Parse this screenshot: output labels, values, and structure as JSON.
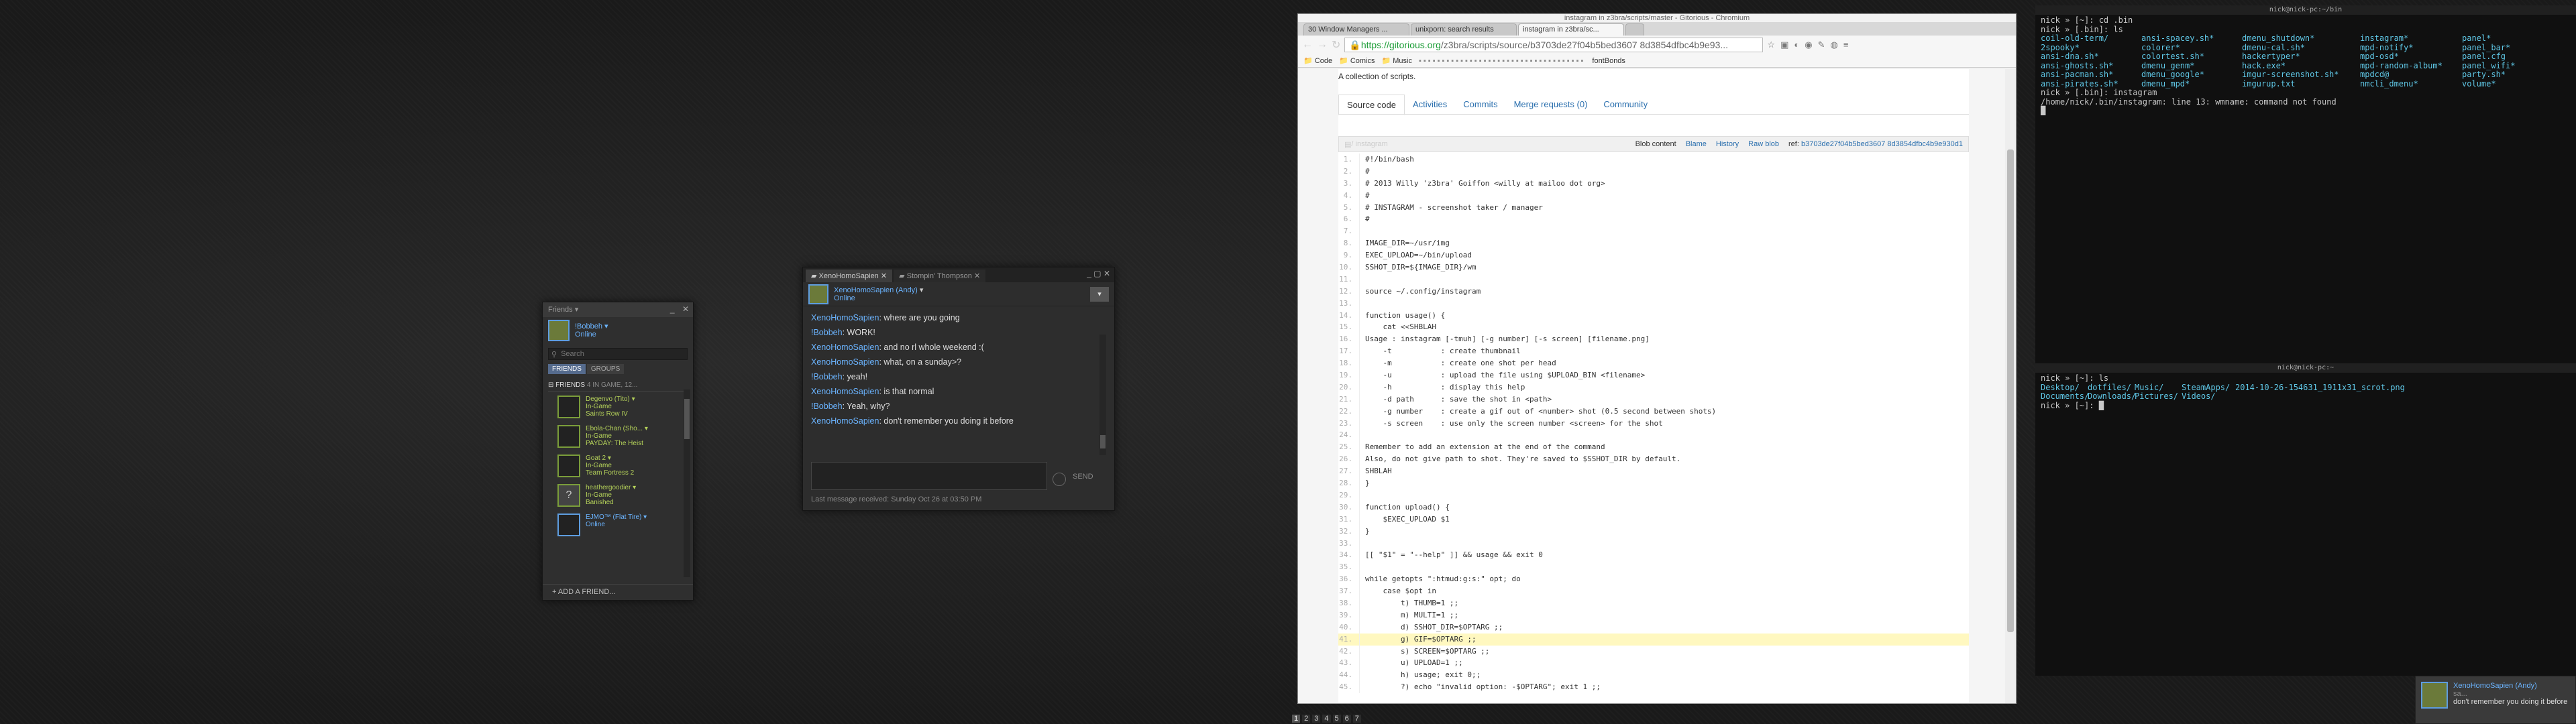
{
  "friends": {
    "title": "Friends",
    "window_controls": [
      "_",
      "✕"
    ],
    "me": {
      "name": "!Bobbeh",
      "status": "Online"
    },
    "search_placeholder": "Search",
    "tabs": [
      "FRIENDS",
      "GROUPS"
    ],
    "group_header": "FRIENDS",
    "group_count": "4 IN GAME, 12...",
    "list": [
      {
        "name": "Degenvo (Tito)",
        "state": "In-Game",
        "game": "Saints Row IV"
      },
      {
        "name": "Ebola-Chan (Sho...",
        "state": "In-Game",
        "game": "PAYDAY: The Heist"
      },
      {
        "name": "Goat 2",
        "state": "In-Game",
        "game": "Team Fortress 2"
      },
      {
        "name": "heathergoodier",
        "state": "In-Game",
        "game": "Banished"
      },
      {
        "name": "EJMO™ (Flat Tire)",
        "state": "Online",
        "game": ""
      }
    ],
    "add_friend": "ADD A FRIEND..."
  },
  "chat": {
    "tabs": [
      "XenoHomoSapien",
      "Stompin' Thompson"
    ],
    "partner": {
      "name": "XenoHomoSapien (Andy)",
      "status": "Online"
    },
    "messages": [
      {
        "from": "XenoHomoSapien",
        "text": ": where are you going"
      },
      {
        "from": "!Bobbeh",
        "text": ": WORK!"
      },
      {
        "from": "XenoHomoSapien",
        "text": ": and no rl whole weekend :("
      },
      {
        "from": "XenoHomoSapien",
        "text": ": what, on a sunday>?"
      },
      {
        "from": "!Bobbeh",
        "text": ": yeah!"
      },
      {
        "from": "XenoHomoSapien",
        "text": ": is that normal"
      },
      {
        "from": "!Bobbeh",
        "text": ": Yeah, why?"
      },
      {
        "from": "XenoHomoSapien",
        "text": ": don't remember you doing it before"
      }
    ],
    "send_label": "SEND",
    "last_message": "Last message received: Sunday Oct 26 at 03:50 PM"
  },
  "browser": {
    "window_title": "instagram in z3bra/scripts/master - Gitorious - Chromium",
    "tabs": [
      "30 Window Managers ...",
      "unixporn: search results",
      "instagram in z3bra/sc..."
    ],
    "url_host": "https://gitorious.org",
    "url_path": "/z3bra/scripts/source/b3703de27f04b5bed3607 8d3854dfbc4b9e93...",
    "bookmarks": [
      "Code",
      "Comics",
      "Music",
      "fontBonds"
    ],
    "description": "A collection of scripts.",
    "project_tabs": [
      "Source code",
      "Activities",
      "Commits",
      "Merge requests (0)",
      "Community"
    ],
    "file_name": "/ instagram",
    "blob_links": [
      "Blob content",
      "Blame",
      "History",
      "Raw blob"
    ],
    "ref_label": "ref:",
    "ref_hash": "b3703de27f04b5bed3607 8d3854dfbc4b9e930d1",
    "code": [
      "#!/bin/bash",
      "#",
      "# 2013 Willy 'z3bra' Goiffon <willy at mailoo dot org>",
      "#",
      "# INSTAGRAM - screenshot taker / manager",
      "#",
      "",
      "IMAGE_DIR=~/usr/img",
      "EXEC_UPLOAD=~/bin/upload",
      "SSHOT_DIR=${IMAGE_DIR}/wm",
      "",
      "source ~/.config/instagram",
      "",
      "function usage() {",
      "    cat <<SHBLAH",
      "Usage : instagram [-tmuh] [-g number] [-s screen] [filename.png]",
      "    -t           : create thumbnail",
      "    -m           : create one shot per head",
      "    -u           : upload the file using $UPLOAD_BIN <filename>",
      "    -h           : display this help",
      "    -d path      : save the shot in <path>",
      "    -g number    : create a gif out of <number> shot (0.5 second between shots)",
      "    -s screen    : use only the screen number <screen> for the shot",
      "",
      "Remember to add an extension at the end of the command",
      "Also, do not give path to shot. They're saved to $SSHOT_DIR by default.",
      "SHBLAH",
      "}",
      "",
      "function upload() {",
      "    $EXEC_UPLOAD $1",
      "}",
      "",
      "[[ \"$1\" = \"--help\" ]] && usage && exit 0",
      "",
      "while getopts \":htmud:g:s:\" opt; do",
      "    case $opt in",
      "        t) THUMB=1 ;;",
      "        m) MULTI=1 ;;",
      "        d) SSHOT_DIR=$OPTARG ;;",
      "        g) GIF=$OPTARG ;;",
      "        s) SCREEN=$OPTARG ;;",
      "        u) UPLOAD=1 ;;",
      "        h) usage; exit 0;;",
      "        ?) echo \"invalid option: -$OPTARG\"; exit 1 ;;"
    ],
    "highlight_line": 41
  },
  "term1": {
    "title": "nick@nick-pc:~/bin",
    "lines_before": [
      "nick » [~]: cd .bin",
      "nick » [.bin]: ls"
    ],
    "ls_columns": [
      [
        "coil-old-term/",
        "2spooky*",
        "ansi-dna.sh*",
        "ansi-ghosts.sh*",
        "ansi-pacman.sh*",
        "ansi-pirates.sh*"
      ],
      [
        "ansi-spacey.sh*",
        "colorer*",
        "colortest.sh*",
        "dmenu_genm*",
        "dmenu_google*",
        "dmenu_mpd*"
      ],
      [
        "dmenu_shutdown*",
        "dmenu-cal.sh*",
        "hackertyper*",
        "hack.exe*",
        "imgur-screenshot.sh*",
        "imgurup.txt"
      ],
      [
        "instagram*",
        "mpd-notify*",
        "mpd-osd*",
        "mpd-random-album*",
        "mpdcd@",
        "nmcli_dmenu*"
      ],
      [
        "panel*",
        "panel_bar*",
        "panel.cfg",
        "panel_wifi*",
        "party.sh*",
        "volume*"
      ]
    ],
    "lines_after": [
      "nick » [.bin]: instagram",
      "/home/nick/.bin/instagram: line 13: wmname: command not found",
      "█"
    ]
  },
  "term2": {
    "title": "nick@nick-pc:~",
    "lines_before": [
      "nick » [~]: ls"
    ],
    "ls_columns": [
      [
        "Desktop/",
        "Documents/"
      ],
      [
        "dotfiles/",
        "Downloads/"
      ],
      [
        "Music/",
        "Pictures/"
      ],
      [
        "SteamApps/",
        "Videos/"
      ],
      [
        "2014-10-26-154631_1911x31_scrot.png",
        ""
      ]
    ],
    "lines_after": [
      "nick » [~]: █"
    ]
  },
  "notification": {
    "name": "XenoHomoSapien (Andy)",
    "says": "sa...",
    "text": "don't remember you doing it before"
  },
  "pager": [
    "1",
    "2",
    "3",
    "4",
    "5",
    "6",
    "7"
  ]
}
